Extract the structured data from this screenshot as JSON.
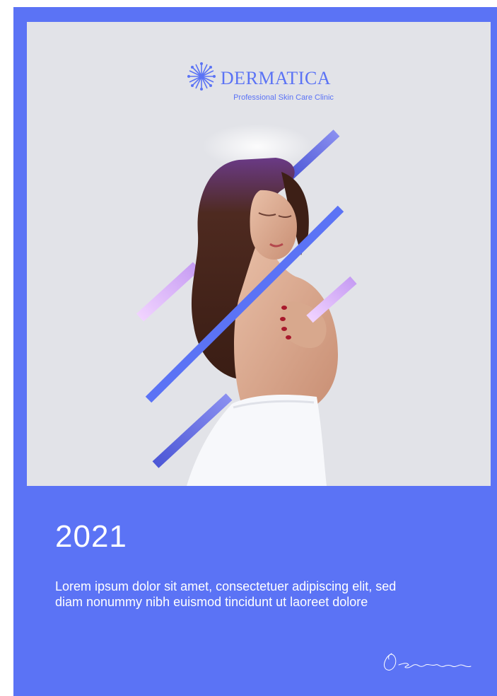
{
  "brand": {
    "name": "DERMATICA",
    "tagline": "Professional Skin Care Clinic",
    "logo_icon": "snowflake-burst-icon"
  },
  "headline": {
    "year": "2021"
  },
  "body": {
    "text": "Lorem ipsum dolor sit amet, consectetuer adipiscing elit, sed diam nonummy nibh euismod tincidunt ut laoreet dolore"
  },
  "signature": {
    "text": "Dermatica"
  },
  "colors": {
    "accent": "#5b73f5",
    "panel": "#e2e3e8",
    "lilac": "#e6c6fb",
    "deep_blue": "#4c57d6",
    "text_light": "#ffffff"
  }
}
